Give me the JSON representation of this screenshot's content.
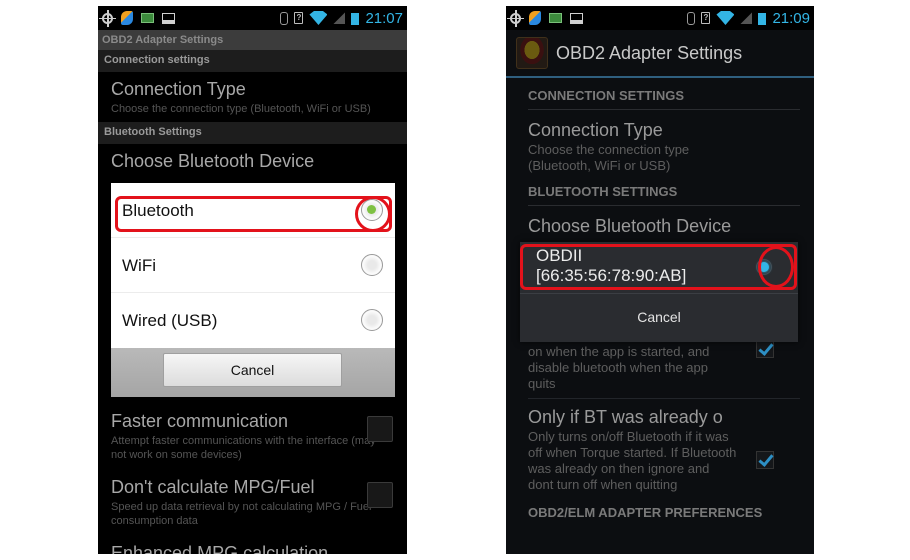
{
  "left_screen": {
    "status_bar": {
      "time": "21:07",
      "icons": [
        "gps-icon",
        "torque-app-icon",
        "obd-icon",
        "image-icon",
        "bluetooth-icon",
        "sim-icon",
        "wifi-icon",
        "signal-icon",
        "battery-icon"
      ]
    },
    "title": "OBD2 Adapter Settings",
    "categories": {
      "connection": "Connection settings",
      "bluetooth": "Bluetooth Settings"
    },
    "connection_type": {
      "title": "Connection Type",
      "summary": "Choose the connection type (Bluetooth, WiFi or USB)"
    },
    "choose_device_title": "Choose Bluetooth Device",
    "dialog": {
      "options": [
        {
          "label": "Bluetooth",
          "selected": true
        },
        {
          "label": "WiFi",
          "selected": false
        },
        {
          "label": "Wired (USB)",
          "selected": false
        }
      ],
      "cancel_label": "Cancel"
    },
    "preferences": [
      {
        "title": "Faster communication",
        "summary": "Attempt faster communications with the interface (may not work on some devices)",
        "checked": false
      },
      {
        "title": "Don't calculate MPG/Fuel",
        "summary": "Speed up data retrieval by not calculating MPG / Fuel consumption data",
        "checked": false
      },
      {
        "title": "Enhanced MPG calculation"
      }
    ],
    "accent_color": "#7ec142"
  },
  "right_screen": {
    "status_bar": {
      "time": "21:09",
      "icons": [
        "gps-icon",
        "torque-app-icon",
        "obd-icon",
        "image-icon",
        "bluetooth-icon",
        "sim-icon",
        "wifi-icon",
        "signal-icon",
        "battery-icon"
      ]
    },
    "title": "OBD2 Adapter Settings",
    "categories": {
      "connection": "CONNECTION SETTINGS",
      "bluetooth": "BLUETOOTH SETTINGS",
      "adapter_prefs": "OBD2/ELM ADAPTER PREFERENCES"
    },
    "connection_type": {
      "title": "Connection Type",
      "summary": "Choose the connection type (Bluetooth, WiFi or USB)"
    },
    "choose_device_title": "Choose Bluetooth Device",
    "dialog": {
      "device_name": "OBDII",
      "device_address": "[66:35:56:78:90:AB]",
      "selected": true,
      "cancel_label": "Cancel"
    },
    "preferences": [
      {
        "summary": "on when the app is started, and disable bluetooth when the app quits",
        "checked": true
      },
      {
        "title": "Only if BT was already o",
        "summary": "Only turns on/off Bluetooth if it was off when Torque started. If Bluetooth was already on then ignore and dont turn off when quitting",
        "checked": true
      }
    ],
    "accent_color": "#33b5e5"
  },
  "highlight_color": "#e3121b"
}
